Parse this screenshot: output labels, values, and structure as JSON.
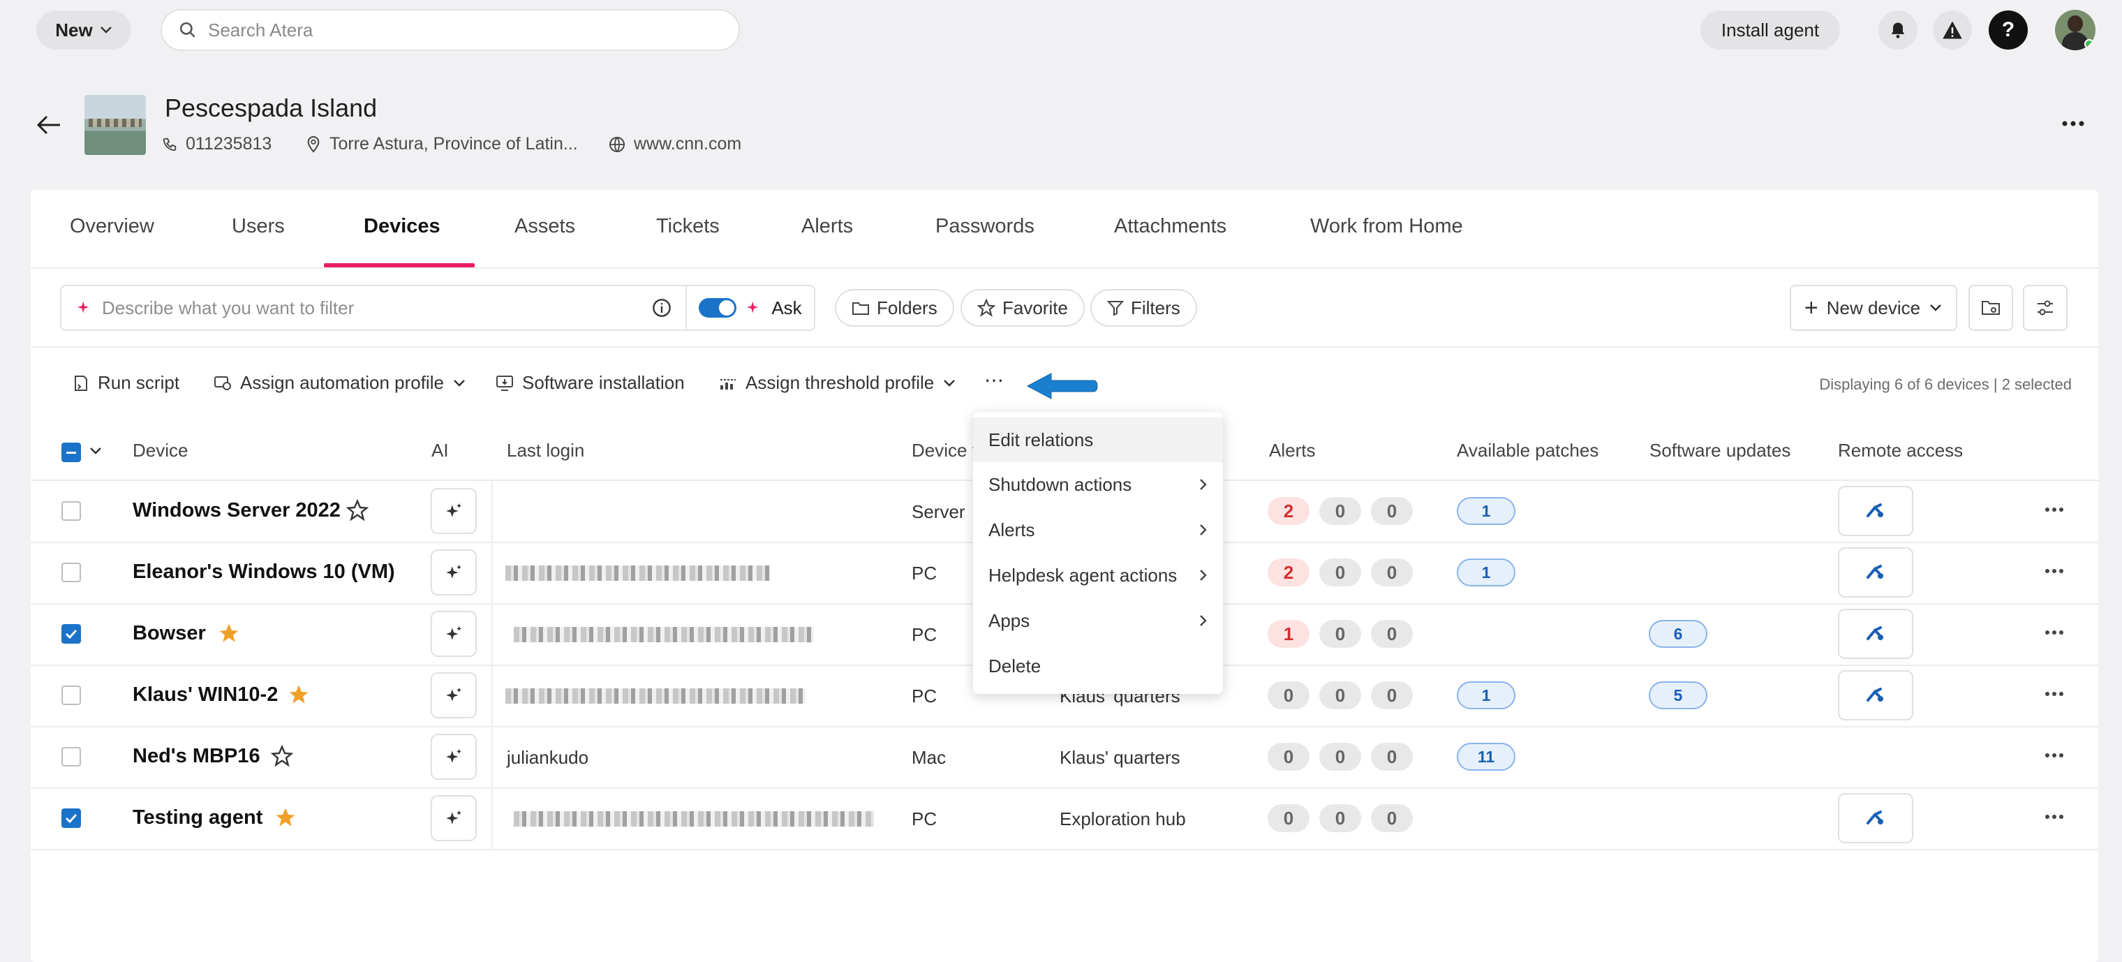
{
  "topbar": {
    "new_label": "New",
    "search_placeholder": "Search Atera",
    "install_label": "Install agent"
  },
  "customer": {
    "name": "Pescespada Island",
    "phone": "011235813",
    "address": "Torre Astura, Province of Latin...",
    "website": "www.cnn.com"
  },
  "tabs": [
    "Overview",
    "Users",
    "Devices",
    "Assets",
    "Tickets",
    "Alerts",
    "Passwords",
    "Attachments",
    "Work from Home"
  ],
  "filter": {
    "placeholder": "Describe what you want to filter",
    "ask_label": "Ask",
    "folders_label": "Folders",
    "favorite_label": "Favorite",
    "filters_label": "Filters",
    "new_device_label": "New device"
  },
  "actions": {
    "run_script": "Run script",
    "assign_automation": "Assign automation profile",
    "software_installation": "Software installation",
    "assign_threshold": "Assign threshold profile",
    "more": "⋯",
    "displaying": "Displaying 6 of 6 devices | 2 selected"
  },
  "columns": {
    "device": "Device",
    "ai": "AI",
    "last_login": "Last login",
    "device_type": "Device t",
    "alerts": "Alerts",
    "available_patches": "Available patches",
    "software_updates": "Software updates",
    "remote_access": "Remote access"
  },
  "rows": [
    {
      "name": "Windows Server 2022",
      "type": "Server",
      "location": "",
      "login": "",
      "a1": "2",
      "a2": "0",
      "a3": "0",
      "patches": "1",
      "updates": ""
    },
    {
      "name": "Eleanor's Windows 10 (VM)",
      "type": "PC",
      "location": "",
      "login": "",
      "a1": "2",
      "a2": "0",
      "a3": "0",
      "patches": "1",
      "updates": ""
    },
    {
      "name": "Bowser",
      "type": "PC",
      "location": "",
      "login": "",
      "a1": "1",
      "a2": "0",
      "a3": "0",
      "patches": "",
      "updates": "6"
    },
    {
      "name": "Klaus' WIN10-2",
      "type": "PC",
      "location": "Klaus' quarters",
      "login": "",
      "a1": "0",
      "a2": "0",
      "a3": "0",
      "patches": "1",
      "updates": "5"
    },
    {
      "name": "Ned's MBP16",
      "type": "Mac",
      "location": "Klaus' quarters",
      "login": "juliankudo",
      "a1": "0",
      "a2": "0",
      "a3": "0",
      "patches": "11",
      "updates": ""
    },
    {
      "name": "Testing agent",
      "type": "PC",
      "location": "Exploration hub",
      "login": "",
      "a1": "0",
      "a2": "0",
      "a3": "0",
      "patches": "",
      "updates": ""
    }
  ],
  "menu": {
    "edit_relations": "Edit relations",
    "shutdown_actions": "Shutdown actions",
    "alerts": "Alerts",
    "helpdesk_agent_actions": "Helpdesk agent actions",
    "apps": "Apps",
    "delete": "Delete"
  },
  "colors": {
    "accent": "#e91e63",
    "primary": "#1a73c8",
    "star": "#f0a028",
    "arrow": "#1a7fcf"
  }
}
